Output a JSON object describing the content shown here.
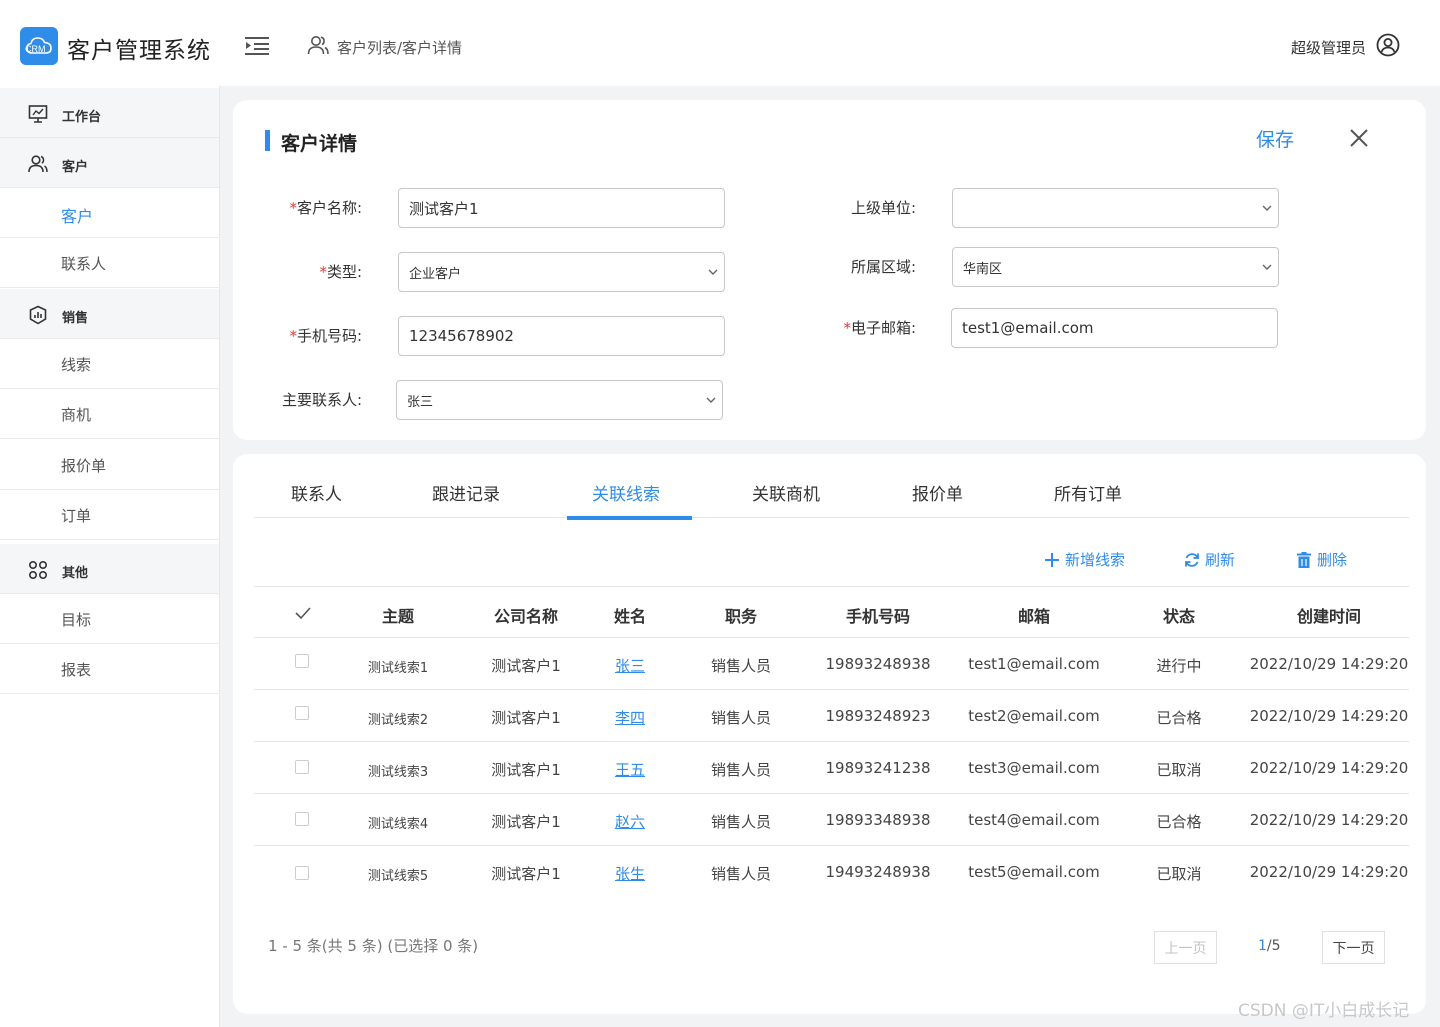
{
  "app": {
    "logo_text": "CRM",
    "title": "客户管理系统"
  },
  "header": {
    "breadcrumb": "客户列表/客户详情",
    "user": "超级管理员"
  },
  "sidebar": {
    "items": [
      {
        "label": "工作台",
        "type": "group",
        "icon": "monitor-icon"
      },
      {
        "label": "客户",
        "type": "group",
        "icon": "users-icon"
      },
      {
        "label": "客户",
        "type": "item",
        "active": true
      },
      {
        "label": "联系人",
        "type": "item"
      },
      {
        "label": "销售",
        "type": "group",
        "icon": "shield-chart-icon"
      },
      {
        "label": "线索",
        "type": "item"
      },
      {
        "label": "商机",
        "type": "item"
      },
      {
        "label": "报价单",
        "type": "item"
      },
      {
        "label": "订单",
        "type": "item"
      },
      {
        "label": "其他",
        "type": "group",
        "icon": "grid-circles-icon"
      },
      {
        "label": "目标",
        "type": "item"
      },
      {
        "label": "报表",
        "type": "item"
      }
    ]
  },
  "detail": {
    "title": "客户详情",
    "save": "保存",
    "fields": {
      "name": {
        "label": "客户名称:",
        "required": "*",
        "value": "测试客户1"
      },
      "type": {
        "label": "类型:",
        "required": "*",
        "value": "企业客户"
      },
      "phone": {
        "label": "手机号码:",
        "required": "*",
        "value": "12345678902"
      },
      "contact": {
        "label": "主要联系人:",
        "value": "张三"
      },
      "parent": {
        "label": "上级单位:",
        "value": ""
      },
      "region": {
        "label": "所属区域:",
        "value": "华南区"
      },
      "email": {
        "label": "电子邮箱:",
        "required": "*",
        "value": "test1@email.com"
      }
    }
  },
  "tabs": [
    "联系人",
    "跟进记录",
    "关联线索",
    "关联商机",
    "报价单",
    "所有订单"
  ],
  "toolbar": {
    "add": "新增线索",
    "refresh": "刷新",
    "delete": "删除"
  },
  "table": {
    "columns": [
      "主题",
      "公司名称",
      "姓名",
      "职务",
      "手机号码",
      "邮箱",
      "状态",
      "创建时间"
    ],
    "rows": [
      [
        "测试线索1",
        "测试客户1",
        "张三",
        "销售人员",
        "19893248938",
        "test1@email.com",
        "进行中",
        "2022/10/29 14:29:20"
      ],
      [
        "测试线索2",
        "测试客户1",
        "李四",
        "销售人员",
        "19893248923",
        "test2@email.com",
        "已合格",
        "2022/10/29 14:29:20"
      ],
      [
        "测试线索3",
        "测试客户1",
        "王五",
        "销售人员",
        "19893241238",
        "test3@email.com",
        "已取消",
        "2022/10/29 14:29:20"
      ],
      [
        "测试线索4",
        "测试客户1",
        "赵六",
        "销售人员",
        "19893348938",
        "test4@email.com",
        "已合格",
        "2022/10/29 14:29:20"
      ],
      [
        "测试线索5",
        "测试客户1",
        "张生",
        "销售人员",
        "19493248938",
        "test5@email.com",
        "已取消",
        "2022/10/29 14:29:20"
      ]
    ]
  },
  "pagination": {
    "info": "1 - 5 条(共 5 条) (已选择 0 条)",
    "prev": "上一页",
    "current": "1",
    "total": "/5",
    "next": "下一页"
  },
  "watermark": "CSDN @IT小白成长记",
  "colors": {
    "accent": "#2f8ce8",
    "required": "#e53935"
  }
}
